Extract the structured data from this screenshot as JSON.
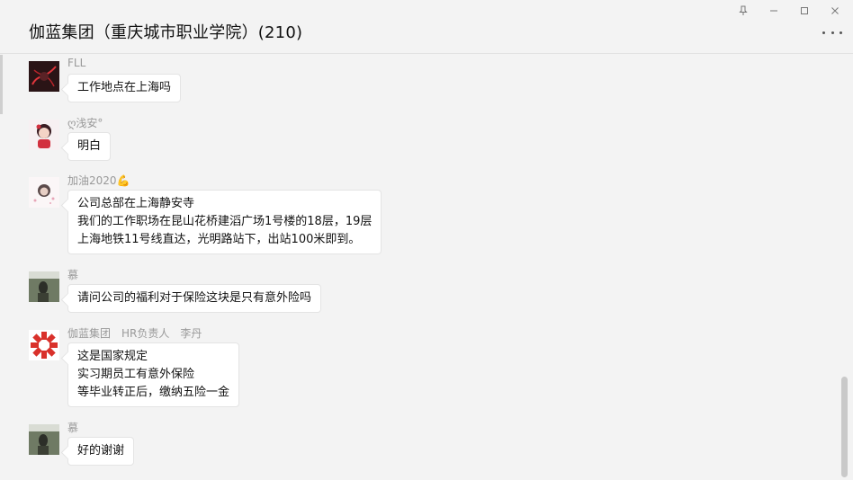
{
  "window": {
    "title": "伽蓝集团（重庆城市职业学院）(210)",
    "controls": [
      "pin-icon",
      "minimize-icon",
      "maximize-icon",
      "close-icon"
    ],
    "more_icon": "more-dots-icon"
  },
  "messages": [
    {
      "sender": "FLL",
      "avatar": "red-lights-avatar",
      "lines": [
        "工作地点在上海吗"
      ]
    },
    {
      "sender": "ღ浅安°",
      "avatar": "cartoon-girl-avatar",
      "lines": [
        "明白"
      ]
    },
    {
      "sender": "加油2020💪",
      "avatar": "girl-photo-avatar",
      "lines": [
        "公司总部在上海静安寺",
        "我们的工作职场在昆山花桥建滔广场1号楼的18层，19层",
        "上海地铁11号线直达，光明路站下，出站100米即到。"
      ]
    },
    {
      "sender": "慕",
      "avatar": "dark-photo-avatar",
      "lines": [
        "请问公司的福利对于保险这块是只有意外险吗"
      ]
    },
    {
      "sender": "伽蓝集团　HR负责人　李丹",
      "avatar": "red-logo-avatar",
      "lines": [
        "这是国家规定",
        "实习期员工有意外保险",
        "等毕业转正后，缴纳五险一金"
      ]
    },
    {
      "sender": "慕",
      "avatar": "dark-photo-avatar",
      "lines": [
        "好的谢谢"
      ]
    }
  ],
  "colors": {
    "background": "#f3f3f3",
    "bubble": "#ffffff",
    "name": "#9a9a9a",
    "logo_red": "#d9312b"
  }
}
